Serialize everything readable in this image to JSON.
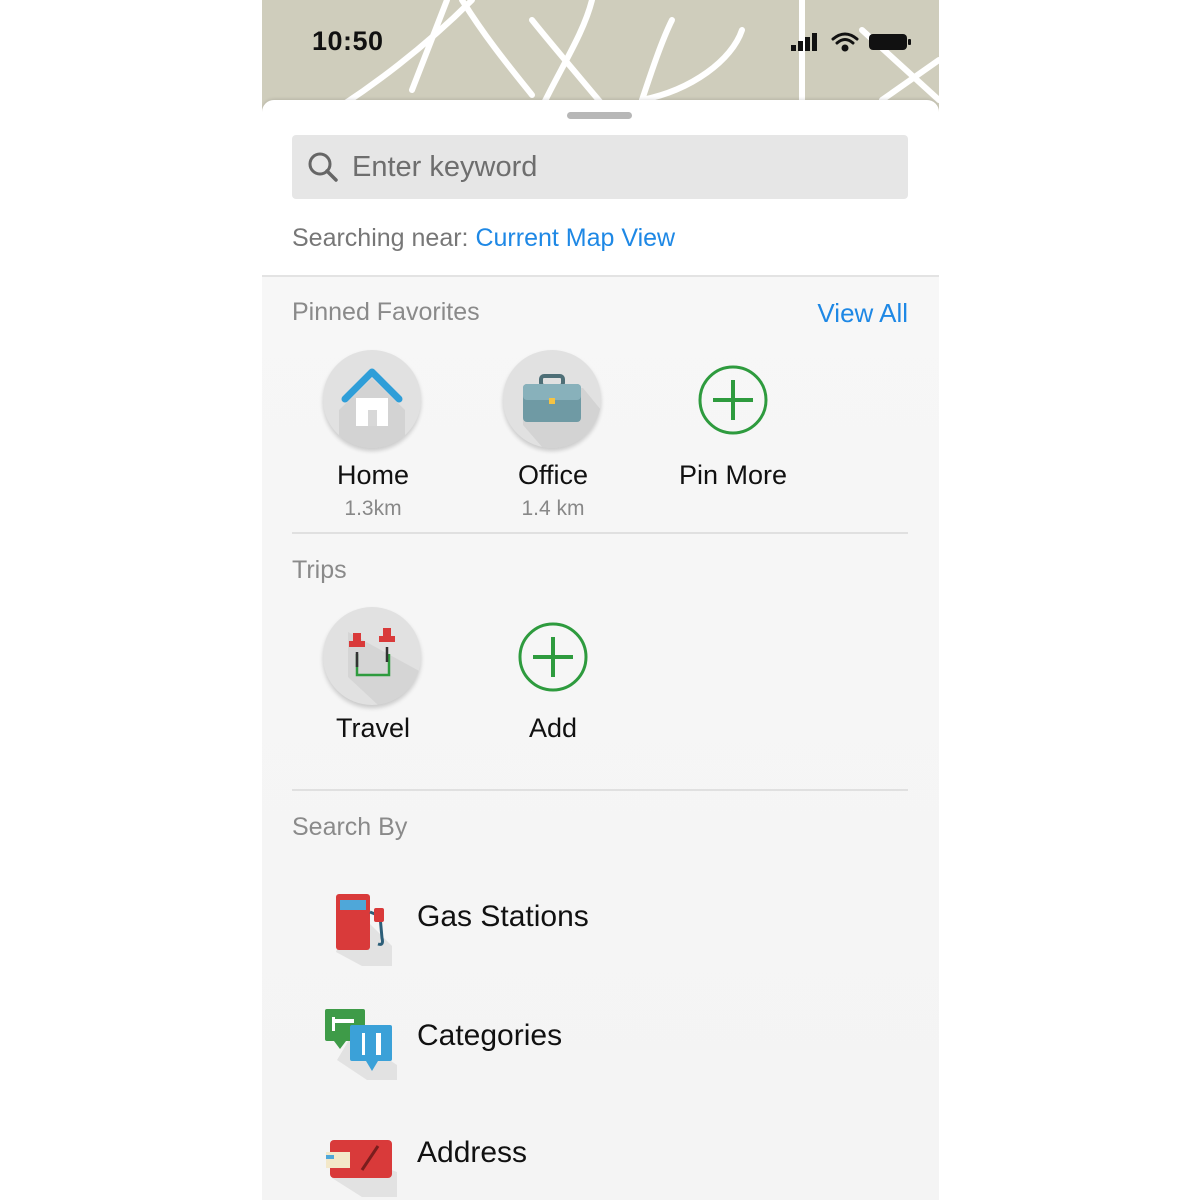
{
  "status_bar": {
    "time": "10:50"
  },
  "search": {
    "placeholder": "Enter keyword",
    "near_prefix": "Searching near:",
    "near_location": "Current Map View"
  },
  "pinned": {
    "title": "Pinned Favorites",
    "view_all": "View All",
    "items": [
      {
        "label": "Home",
        "distance": "1.3km",
        "icon": "home-icon"
      },
      {
        "label": "Office",
        "distance": "1.4 km",
        "icon": "briefcase-icon"
      },
      {
        "label": "Pin More",
        "icon": "add-circle-icon"
      }
    ]
  },
  "trips": {
    "title": "Trips",
    "items": [
      {
        "label": "Travel",
        "icon": "route-pins-icon"
      },
      {
        "label": "Add",
        "icon": "add-circle-icon"
      }
    ]
  },
  "search_by": {
    "title": "Search By",
    "items": [
      {
        "label": "Gas Stations",
        "icon": "gas-pump-icon"
      },
      {
        "label": "Categories",
        "icon": "categories-icon"
      },
      {
        "label": "Address",
        "icon": "address-icon"
      }
    ]
  },
  "colors": {
    "accent_blue": "#1e88e5",
    "add_green": "#2e9b3e",
    "map_bg": "#cfcdbc"
  }
}
